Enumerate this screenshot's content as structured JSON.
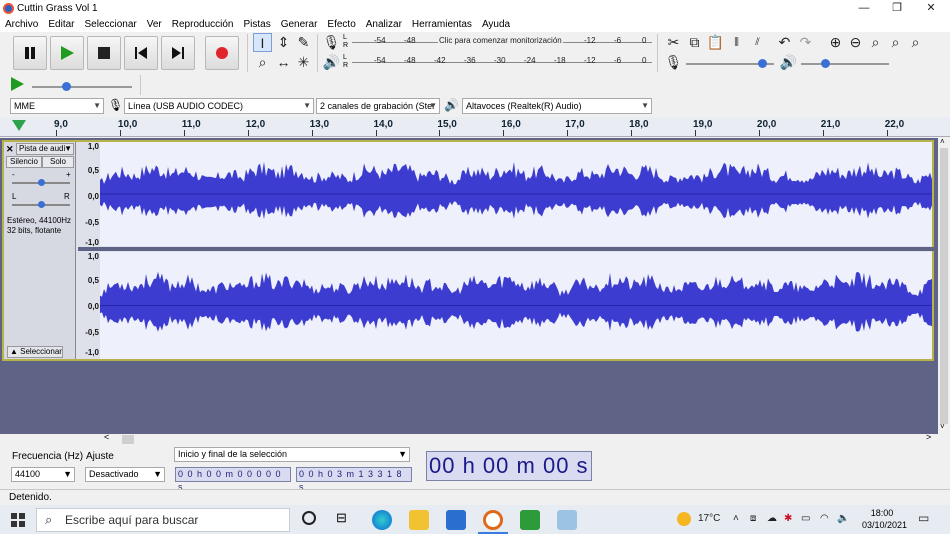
{
  "window": {
    "title": "Cuttin Grass Vol 1",
    "minimize": "—",
    "maximize": "❐",
    "close": "✕"
  },
  "menu": [
    "Archivo",
    "Editar",
    "Seleccionar",
    "Ver",
    "Reproducción",
    "Pistas",
    "Generar",
    "Efecto",
    "Analizar",
    "Herramientas",
    "Ayuda"
  ],
  "meters": {
    "record_monitor_text": "Clic para comenzar monitorización",
    "scale": [
      "-54",
      "-48",
      "-42",
      "-36",
      "-30",
      "-24",
      "-18",
      "-12",
      "-6",
      "0"
    ],
    "lr": [
      "L",
      "R"
    ]
  },
  "devices": {
    "host": "MME",
    "input": "Línea (USB AUDIO  CODEC)",
    "channels": "2 canales de grabación (Ster",
    "output": "Altavoces (Realtek(R) Audio)"
  },
  "ruler": [
    "9,0",
    "10,0",
    "11,0",
    "12,0",
    "13,0",
    "14,0",
    "15,0",
    "16,0",
    "17,0",
    "18,0",
    "19,0",
    "20,0",
    "21,0",
    "22,0"
  ],
  "track": {
    "name": "Pista de audi",
    "mute": "Silencio",
    "solo": "Solo",
    "gain_minus": "-",
    "gain_plus": "+",
    "pan_left": "L",
    "pan_right": "R",
    "info_line1": "Estéreo, 44100Hz",
    "info_line2": "32 bits, flotante",
    "select_label": "Seleccionar",
    "scale": [
      "1,0",
      "0,5",
      "0,0",
      "-0,5",
      "-1,0"
    ]
  },
  "selection_bar": {
    "rate_label": "Frecuencia (Hz)",
    "snap_label": "Ajuste",
    "rate_value": "44100",
    "snap_value": "Desactivado",
    "mode": "Inicio y final de la selección",
    "start": "0 0 h 0 0 m 0 0 0 0 0 s",
    "end": "0 0 h 0 3 m 1 3 3 1 8 s",
    "position": "00 h 00 m 00 s"
  },
  "status": "Detenido.",
  "taskbar": {
    "search_placeholder": "Escribe aquí para buscar",
    "weather": "17°C",
    "time": "18:00",
    "date": "03/10/2021"
  }
}
